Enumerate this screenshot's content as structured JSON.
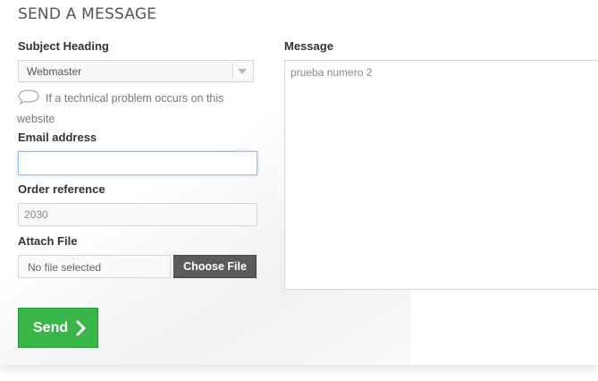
{
  "form": {
    "title": "SEND A MESSAGE",
    "subject_label": "Subject Heading",
    "subject_value": "Webmaster",
    "hint_text": "If a technical problem occurs on this website",
    "email_label": "Email address",
    "email_value": "",
    "order_label": "Order reference",
    "order_value": "2030",
    "attach_label": "Attach File",
    "file_status": "No file selected",
    "choose_file_label": "Choose File",
    "message_label": "Message",
    "message_value": "prueba numero 2",
    "send_label": "Send"
  },
  "icons": {
    "hint": "speech-bubble-icon",
    "send": "chevron-right-icon",
    "select": "dropdown-arrow-icon"
  },
  "colors": {
    "send_button": "#3ab54a",
    "choose_file_button": "#5b5b5b",
    "focus_border": "#8ec4e8"
  }
}
